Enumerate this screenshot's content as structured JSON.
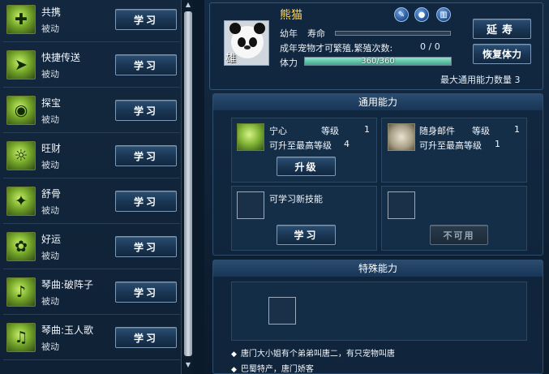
{
  "skills": [
    {
      "name": "共携",
      "type": "被动",
      "button": "学习",
      "icon": "sack-icon"
    },
    {
      "name": "快捷传送",
      "type": "被动",
      "button": "学习",
      "icon": "teleport-icon"
    },
    {
      "name": "探宝",
      "type": "被动",
      "button": "学习",
      "icon": "eye-icon"
    },
    {
      "name": "旺财",
      "type": "被动",
      "button": "学习",
      "icon": "sun-moon-icon"
    },
    {
      "name": "舒骨",
      "type": "被动",
      "button": "学习",
      "icon": "pet-run-icon"
    },
    {
      "name": "好运",
      "type": "被动",
      "button": "学习",
      "icon": "luck-icon"
    },
    {
      "name": "琴曲:破阵子",
      "type": "被动",
      "button": "学习",
      "icon": "qin-icon"
    },
    {
      "name": "琴曲:玉人歌",
      "type": "被动",
      "button": "学习",
      "icon": "qin-icon"
    }
  ],
  "pet": {
    "name": "熊猫",
    "gender": "雄",
    "age_label": "幼年",
    "life_label": "寿命",
    "life_fraction": 0.0,
    "breed_text": "成年宠物才可繁殖,繁殖次数:",
    "breed_count": "0 / 0",
    "hp_label": "体力",
    "hp_text": "360/360",
    "hp_fraction": 1.0,
    "max_ability_label": "最大通用能力数量",
    "max_ability_value": "3",
    "tools": [
      "brush-icon",
      "orb-icon",
      "trash-icon"
    ]
  },
  "buttons": {
    "extend": "延寿",
    "restore": "恢复体力",
    "upgrade": "升级",
    "learn": "学习",
    "unavailable": "不可用"
  },
  "general": {
    "title": "通用能力",
    "slots": [
      {
        "name": "宁心",
        "level_label": "等级",
        "level": "1",
        "max_text": "可升至最高等级",
        "max_level": "4",
        "icon": "meditation-icon"
      },
      {
        "name": "随身邮件",
        "level_label": "等级",
        "level": "1",
        "max_text": "可升至最高等级",
        "max_level": "1",
        "icon": "horse-cart-icon"
      }
    ],
    "learn_new": "可学习新技能"
  },
  "special": {
    "title": "特殊能力",
    "notes": [
      "唐门大小姐有个弟弟叫唐二，有只宠物叫唐",
      "巴蜀特产，唐门娇客"
    ]
  }
}
